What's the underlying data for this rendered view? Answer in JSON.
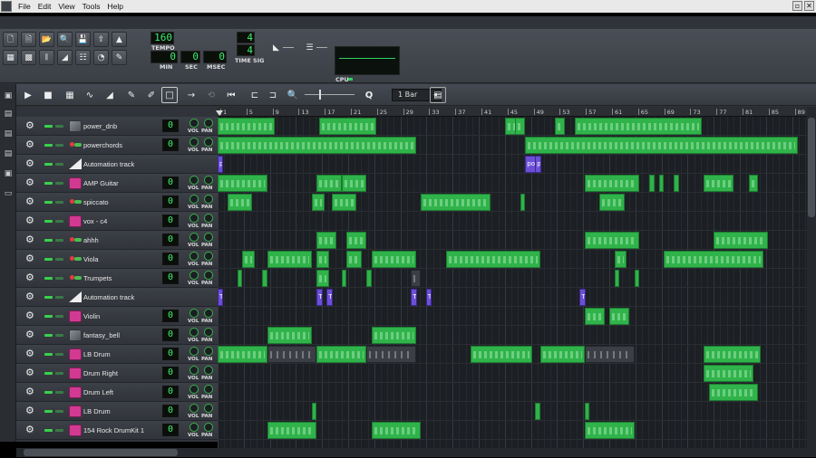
{
  "menu": {
    "items": [
      "File",
      "Edit",
      "View",
      "Tools",
      "Help"
    ]
  },
  "toolbar": {
    "tempo": "160",
    "tempo_label": "TEMPO",
    "min": "0",
    "sec": "0",
    "msec": "0",
    "min_label": "MIN",
    "sec_label": "SEC",
    "msec_label": "MSEC",
    "timesig_num": "4",
    "timesig_den": "4",
    "timesig_label": "TIME SIG",
    "cpu_label": "CPU"
  },
  "song_toolbar": {
    "zoom": "1 Bar"
  },
  "ruler": {
    "ticks": [
      "1",
      "5",
      "9",
      "13",
      "17",
      "21",
      "25",
      "29",
      "33",
      "37",
      "41",
      "45",
      "49",
      "53",
      "57",
      "61",
      "65",
      "69",
      "73",
      "77",
      "81",
      "85",
      "89"
    ]
  },
  "tracks": [
    {
      "name": "power_dnb",
      "icon": "sample",
      "vol": "0",
      "clips": [
        [
          0,
          11.5
        ],
        [
          20.5,
          11.5
        ],
        [
          58,
          3
        ],
        [
          60,
          2
        ],
        [
          72,
          25.5
        ],
        [
          68,
          2
        ]
      ]
    },
    {
      "name": "powerchords",
      "icon": "triple",
      "vol": "0",
      "clips": [
        [
          0,
          40
        ],
        [
          62,
          55
        ]
      ]
    },
    {
      "name": "Automation track",
      "icon": "automation",
      "vol": null,
      "auto": [
        [
          0,
          1,
          "p"
        ],
        [
          62,
          2,
          "pov"
        ],
        [
          64,
          1,
          "p"
        ]
      ]
    },
    {
      "name": "AMP Guitar",
      "icon": "pink",
      "vol": "0",
      "clips": [
        [
          0,
          10
        ],
        [
          20,
          5
        ],
        [
          25,
          5
        ],
        [
          74,
          11
        ],
        [
          87,
          1
        ],
        [
          89,
          1
        ],
        [
          92,
          1
        ],
        [
          98,
          6
        ],
        [
          107,
          2
        ]
      ]
    },
    {
      "name": "spiccato",
      "icon": "triple",
      "vol": "0",
      "clips": [
        [
          2,
          5
        ],
        [
          19,
          2.5
        ],
        [
          23,
          5
        ],
        [
          41,
          14
        ],
        [
          61,
          1
        ],
        [
          77,
          5
        ]
      ]
    },
    {
      "name": "vox - c4",
      "icon": "pink",
      "vol": "0",
      "clips": []
    },
    {
      "name": "ahhh",
      "icon": "triple",
      "vol": "0",
      "clips": [
        [
          20,
          4
        ],
        [
          26,
          4
        ],
        [
          74,
          11
        ],
        [
          100,
          11
        ]
      ]
    },
    {
      "name": "Viola",
      "icon": "triple",
      "vol": "0",
      "clips": [
        [
          5,
          2.5
        ],
        [
          10,
          9
        ],
        [
          20,
          2.5
        ],
        [
          26,
          3
        ],
        [
          31,
          9
        ],
        [
          46,
          19
        ],
        [
          80,
          2.5
        ],
        [
          90,
          20
        ]
      ]
    },
    {
      "name": "Trumpets",
      "icon": "triple",
      "vol": "0",
      "clips": [
        [
          4,
          1
        ],
        [
          9,
          1
        ],
        [
          20,
          2.5
        ],
        [
          25,
          1
        ],
        [
          30,
          1
        ],
        [
          80,
          1
        ],
        [
          84,
          1
        ]
      ],
      "bb": [
        [
          39,
          2
        ]
      ]
    },
    {
      "name": "Automation track",
      "icon": "automation",
      "vol": null,
      "auto": [
        [
          0,
          1,
          "T"
        ],
        [
          20,
          1,
          "Ti"
        ],
        [
          22,
          1,
          "T"
        ],
        [
          39,
          1,
          "T"
        ],
        [
          42,
          1,
          "T"
        ],
        [
          73,
          1,
          "T"
        ]
      ]
    },
    {
      "name": "Violin",
      "icon": "pink",
      "vol": "0",
      "clips": [
        [
          74,
          4
        ],
        [
          79,
          4
        ]
      ]
    },
    {
      "name": "fantasy_bell",
      "icon": "sample",
      "vol": "0",
      "clips": [
        [
          10,
          9
        ],
        [
          31,
          9
        ]
      ]
    },
    {
      "name": "LB Drum",
      "icon": "pink",
      "vol": "0",
      "clips": [
        [
          0,
          10
        ],
        [
          20,
          10
        ],
        [
          51,
          12.5
        ],
        [
          65,
          9
        ],
        [
          98,
          11.5
        ]
      ],
      "bb": [
        [
          10,
          10
        ],
        [
          30,
          10
        ],
        [
          74,
          10
        ]
      ]
    },
    {
      "name": "Drum Right",
      "icon": "pink",
      "vol": "0",
      "clips": [
        [
          98,
          10
        ]
      ]
    },
    {
      "name": "Drum Left",
      "icon": "pink",
      "vol": "0",
      "clips": [
        [
          99,
          10
        ]
      ]
    },
    {
      "name": "LB Drum",
      "icon": "pink",
      "vol": "0",
      "clips": [
        [
          19,
          1
        ],
        [
          64,
          1
        ],
        [
          74,
          1
        ]
      ]
    },
    {
      "name": "154 Rock DrumKit 1",
      "icon": "pink",
      "vol": "0",
      "clips": [
        [
          10,
          10
        ],
        [
          31,
          10
        ],
        [
          74,
          10
        ]
      ]
    }
  ],
  "colors": {
    "clip": "#2fb34a",
    "automation": "#6c4fd6",
    "lcd_text": "#3ef070",
    "pink": "#d23a92"
  }
}
